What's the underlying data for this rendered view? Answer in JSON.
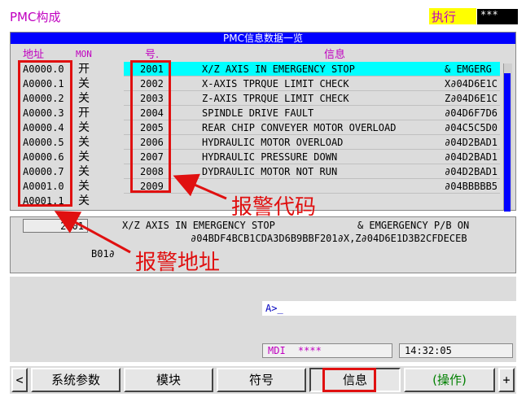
{
  "header": {
    "screen_title": "PMC构成",
    "exec_label": "执行",
    "exec_status": "***"
  },
  "list": {
    "title": "PMC信息数据一览",
    "col_address": "地址",
    "col_mon": "MON",
    "col_number": "号.",
    "col_message": "信息",
    "rows": [
      {
        "address": "A0000.0",
        "mon": "开",
        "number": "2001",
        "message": "X/Z AXIS IN EMERGENCY STOP",
        "extra": "& EMGERG"
      },
      {
        "address": "A0000.1",
        "mon": "关",
        "number": "2002",
        "message": "X-AXIS TPRQUE LIMIT CHECK",
        "extra": "X∂04D6E1C"
      },
      {
        "address": "A0000.2",
        "mon": "关",
        "number": "2003",
        "message": "Z-AXIS TPRQUE LIMIT CHECK",
        "extra": "Z∂04D6E1C"
      },
      {
        "address": "A0000.3",
        "mon": "开",
        "number": "2004",
        "message": "SPINDLE DRIVE FAULT",
        "extra": "∂04D6F7D6"
      },
      {
        "address": "A0000.4",
        "mon": "关",
        "number": "2005",
        "message": "REAR CHIP CONVEYER MOTOR OVERLOAD",
        "extra": "∂04C5C5D0"
      },
      {
        "address": "A0000.5",
        "mon": "关",
        "number": "2006",
        "message": "HYDRAULIC MOTOR OVERLOAD",
        "extra": "∂04D2BAD1"
      },
      {
        "address": "A0000.6",
        "mon": "关",
        "number": "2007",
        "message": "HYDRAULIC PRESSURE DOWN",
        "extra": "∂04D2BAD1"
      },
      {
        "address": "A0000.7",
        "mon": "关",
        "number": "2008",
        "message": "DYDRAULIC MOTOR NOT RUN",
        "extra": "∂04D2BAD1"
      },
      {
        "address": "A0001.0",
        "mon": "关",
        "number": "2009",
        "message": "",
        "extra": "∂04BBBBB5"
      },
      {
        "address": "A0001.1",
        "mon": "关",
        "number": "",
        "message": "",
        "extra": ""
      }
    ]
  },
  "detail": {
    "number": "2001",
    "line1": "X/Z AXIS IN EMERGENCY STOP              & EMGERGENCY P/B ON",
    "line2": "∂04BDF4BCB1CDA3D6B9BBF201∂X,Z∂04D6E1D3B2CFDECEB",
    "line3": "B01∂"
  },
  "input": {
    "prompt": "A>_"
  },
  "status": {
    "mode": "MDI",
    "mode_stars": "****",
    "time": "14:32:05"
  },
  "softkeys": {
    "prev": "<",
    "items": [
      "系统参数",
      "模块",
      "符号",
      "信息",
      "(操作)"
    ],
    "next": "+"
  },
  "annotations": {
    "alarm_code_label": "报警代码",
    "alarm_address_label": "报警地址"
  },
  "colors": {
    "title_bar": "#0000ff",
    "highlight_row": "#00ffff",
    "annotation_red": "#e01010",
    "exec_yellow": "#ffff00",
    "magenta_text": "#c000c0"
  }
}
